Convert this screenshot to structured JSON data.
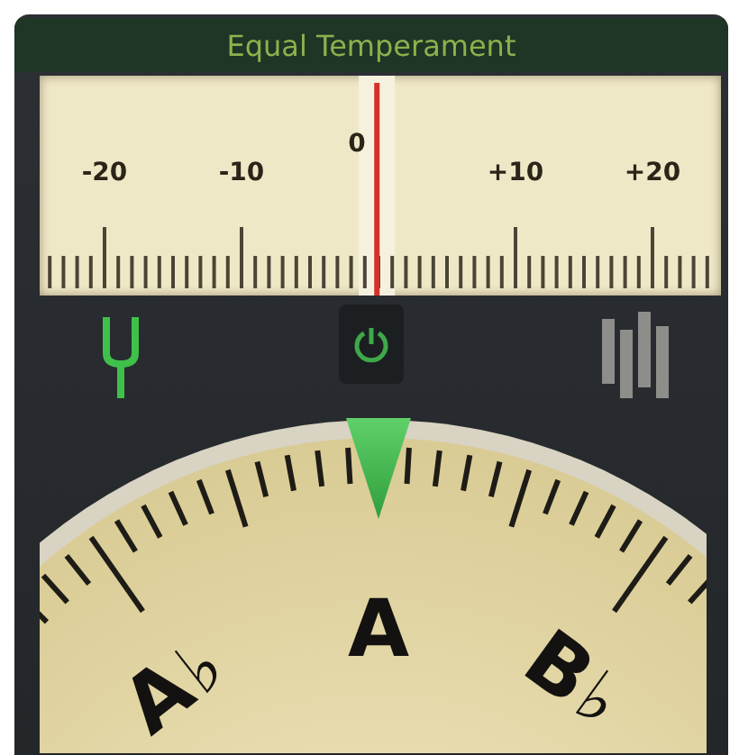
{
  "title": "Equal Temperament",
  "cent_scale": {
    "labels": [
      "-20",
      "-10",
      "0",
      "+10",
      "+20"
    ],
    "needle": {
      "level": 0.495
    }
  },
  "toolbar": {
    "modes": [
      {
        "kind": "fork",
        "selected": true
      },
      {
        "kind": "bars",
        "selected": false
      }
    ],
    "power": {
      "on": true
    }
  },
  "dial": {
    "in_tune": true,
    "notes": [
      {
        "letter": "A",
        "accidental": "♭"
      },
      {
        "letter": "A"
      },
      {
        "letter": "B",
        "accidental": "♭"
      }
    ]
  }
}
